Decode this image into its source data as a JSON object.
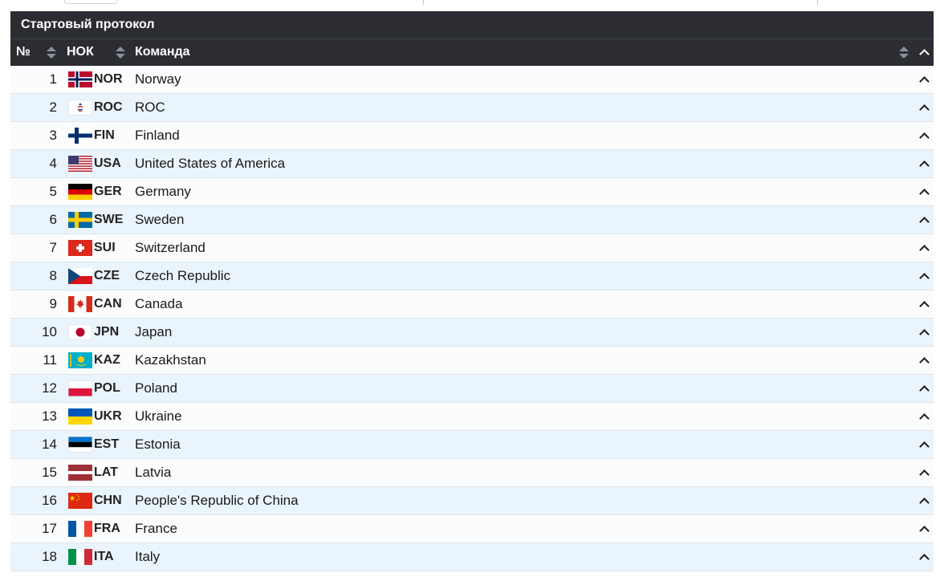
{
  "table": {
    "title": "Стартовый протокол",
    "columns": {
      "num": "№",
      "noc": "НОК",
      "team": "Команда"
    }
  },
  "rows": [
    {
      "num": "1",
      "noc": "NOR",
      "team": "Norway"
    },
    {
      "num": "2",
      "noc": "ROC",
      "team": "ROC"
    },
    {
      "num": "3",
      "noc": "FIN",
      "team": "Finland"
    },
    {
      "num": "4",
      "noc": "USA",
      "team": "United States of America"
    },
    {
      "num": "5",
      "noc": "GER",
      "team": "Germany"
    },
    {
      "num": "6",
      "noc": "SWE",
      "team": "Sweden"
    },
    {
      "num": "7",
      "noc": "SUI",
      "team": "Switzerland"
    },
    {
      "num": "8",
      "noc": "CZE",
      "team": "Czech Republic"
    },
    {
      "num": "9",
      "noc": "CAN",
      "team": "Canada"
    },
    {
      "num": "10",
      "noc": "JPN",
      "team": "Japan"
    },
    {
      "num": "11",
      "noc": "KAZ",
      "team": "Kazakhstan"
    },
    {
      "num": "12",
      "noc": "POL",
      "team": "Poland"
    },
    {
      "num": "13",
      "noc": "UKR",
      "team": "Ukraine"
    },
    {
      "num": "14",
      "noc": "EST",
      "team": "Estonia"
    },
    {
      "num": "15",
      "noc": "LAT",
      "team": "Latvia"
    },
    {
      "num": "16",
      "noc": "CHN",
      "team": "People's Republic of China"
    },
    {
      "num": "17",
      "noc": "FRA",
      "team": "France"
    },
    {
      "num": "18",
      "noc": "ITA",
      "team": "Italy"
    }
  ]
}
